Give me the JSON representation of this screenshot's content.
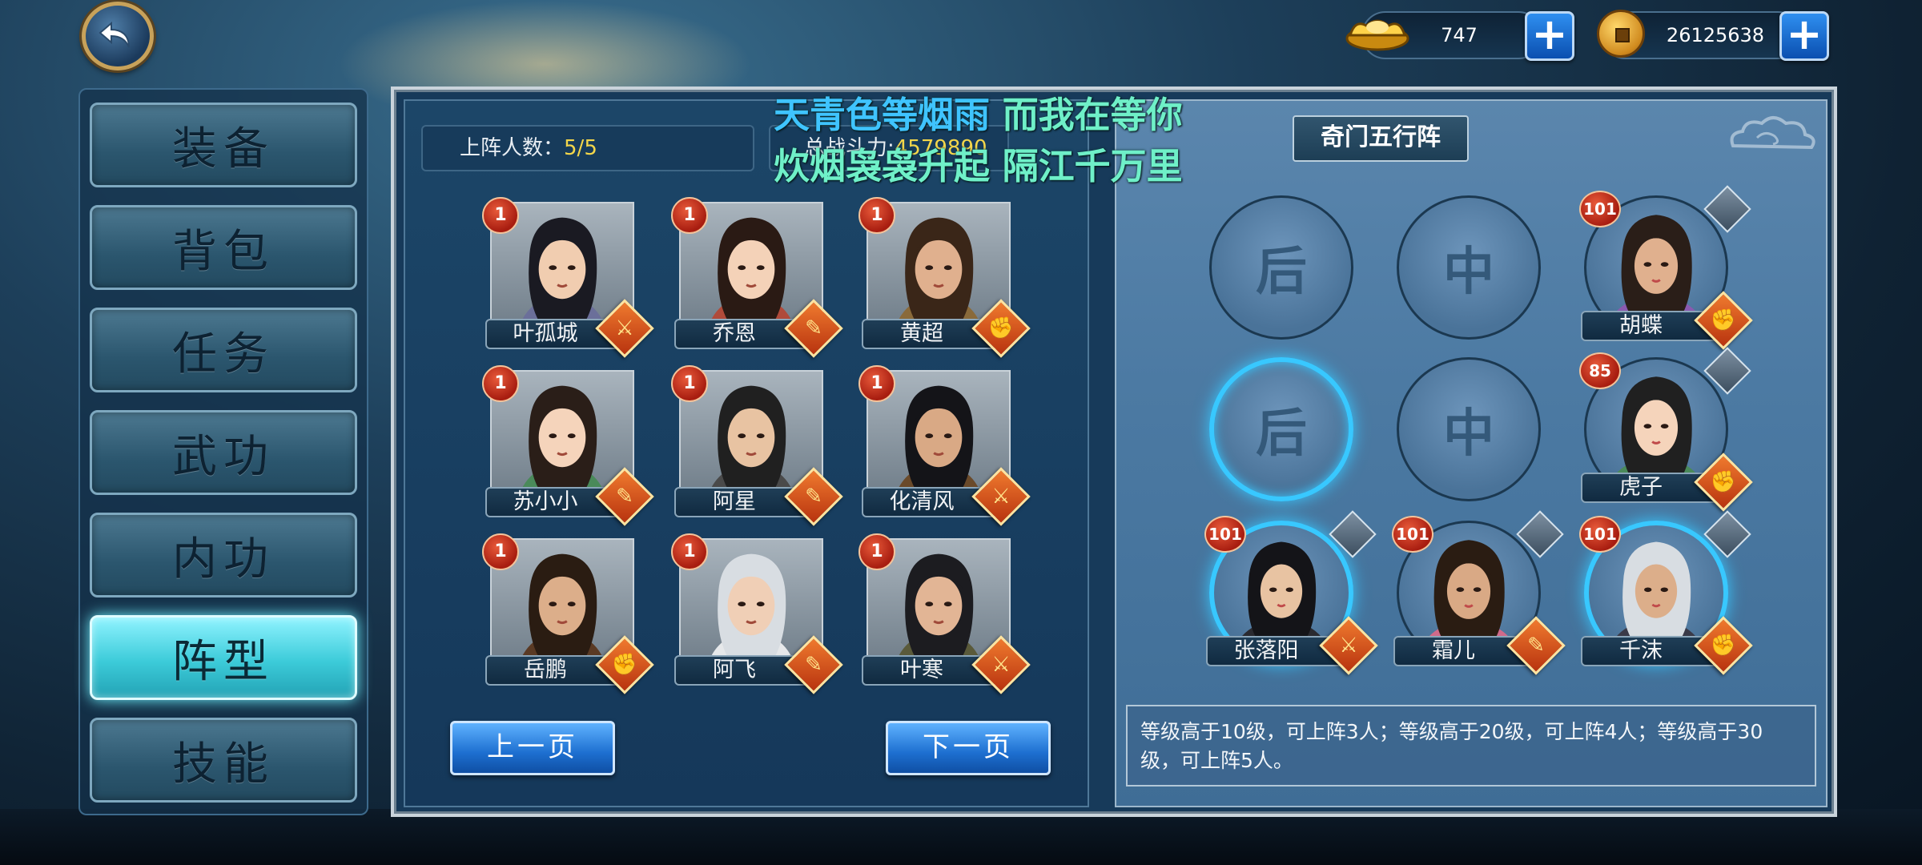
{
  "currency": {
    "gold": "747",
    "coins": "26125638"
  },
  "sidebar": {
    "items": [
      {
        "label": "装备",
        "active": false
      },
      {
        "label": "背包",
        "active": false
      },
      {
        "label": "任务",
        "active": false
      },
      {
        "label": "武功",
        "active": false
      },
      {
        "label": "内功",
        "active": false
      },
      {
        "label": "阵型",
        "active": true
      },
      {
        "label": "技能",
        "active": false
      }
    ]
  },
  "roster": {
    "count_label": "上阵人数：",
    "count_value": "5/5",
    "power_label": "总战斗力:",
    "power_value": "4579890",
    "heroes": [
      {
        "name": "叶孤城",
        "level": "1",
        "class": "sword"
      },
      {
        "name": "乔恩",
        "level": "1",
        "class": "blade"
      },
      {
        "name": "黄超",
        "level": "1",
        "class": "fist"
      },
      {
        "name": "苏小小",
        "level": "1",
        "class": "blade"
      },
      {
        "name": "阿星",
        "level": "1",
        "class": "blade"
      },
      {
        "name": "化清风",
        "level": "1",
        "class": "sword"
      },
      {
        "name": "岳鹏",
        "level": "1",
        "class": "fist"
      },
      {
        "name": "阿飞",
        "level": "1",
        "class": "blade"
      },
      {
        "name": "叶寒",
        "level": "1",
        "class": "sword"
      }
    ],
    "prev_label": "上一页",
    "next_label": "下一页"
  },
  "formation": {
    "title": "奇门五行阵",
    "empty_slots": [
      "后",
      "中",
      "后",
      "中"
    ],
    "placed": [
      {
        "name": "胡蝶",
        "level": "101",
        "class": "fist"
      },
      {
        "name": "虎子",
        "level": "85",
        "class": "fist"
      },
      {
        "name": "张落阳",
        "level": "101",
        "class": "sword"
      },
      {
        "name": "霜儿",
        "level": "101",
        "class": "blade"
      },
      {
        "name": "千沫",
        "level": "101",
        "class": "fist"
      }
    ],
    "info": "等级高于10级，可上阵3人；等级高于20级，可上阵4人；等级高于30级，可上阵5人。"
  },
  "lyrics": {
    "line1a": "天青色等烟雨",
    "line1b": " 而我在等你",
    "line2": "炊烟袅袅升起 隔江千万里"
  },
  "colors": {
    "accent_cyan": "#38c8ff",
    "level_badge": "#c0281a",
    "value_yellow": "#f3d64a"
  }
}
